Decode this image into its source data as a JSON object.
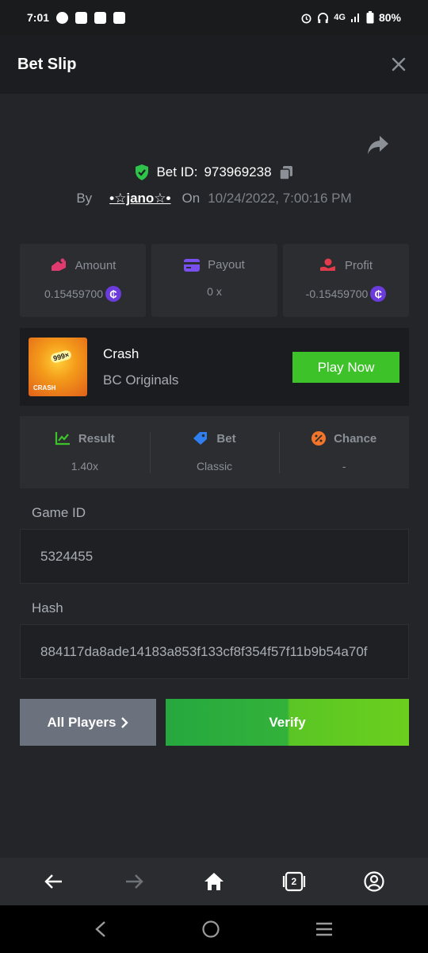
{
  "status_bar": {
    "time": "7:01",
    "network": "4G",
    "battery": "80%"
  },
  "header": {
    "title": "Bet Slip"
  },
  "bet": {
    "id_label": "Bet ID:",
    "id": "973969238",
    "by_label": "By",
    "user": "•☆jano☆•",
    "on_label": "On",
    "date": "10/24/2022, 7:00:16 PM"
  },
  "stats": {
    "amount": {
      "label": "Amount",
      "value": "0.15459700"
    },
    "payout": {
      "label": "Payout",
      "value": "0 x"
    },
    "profit": {
      "label": "Profit",
      "value": "-0.15459700"
    },
    "coin_symbol": "₵"
  },
  "game": {
    "thumb_tag": "CRASH",
    "thumb_mult": "999×",
    "name": "Crash",
    "provider": "BC Originals",
    "play_label": "Play Now"
  },
  "details": {
    "result": {
      "label": "Result",
      "value": "1.40x"
    },
    "bet": {
      "label": "Bet",
      "value": "Classic"
    },
    "chance": {
      "label": "Chance",
      "value": "-"
    }
  },
  "fields": {
    "game_id_label": "Game ID",
    "game_id": "5324455",
    "hash_label": "Hash",
    "hash": "884117da8ade14183a853f133cf8f354f57f11b9b54a70f"
  },
  "actions": {
    "all_players": "All Players",
    "verify": "Verify"
  },
  "browser": {
    "tab_count": "2"
  },
  "colors": {
    "accent_green": "#3dc329",
    "shield_green": "#2ec44a",
    "coin_purple": "#6b3bdb"
  }
}
